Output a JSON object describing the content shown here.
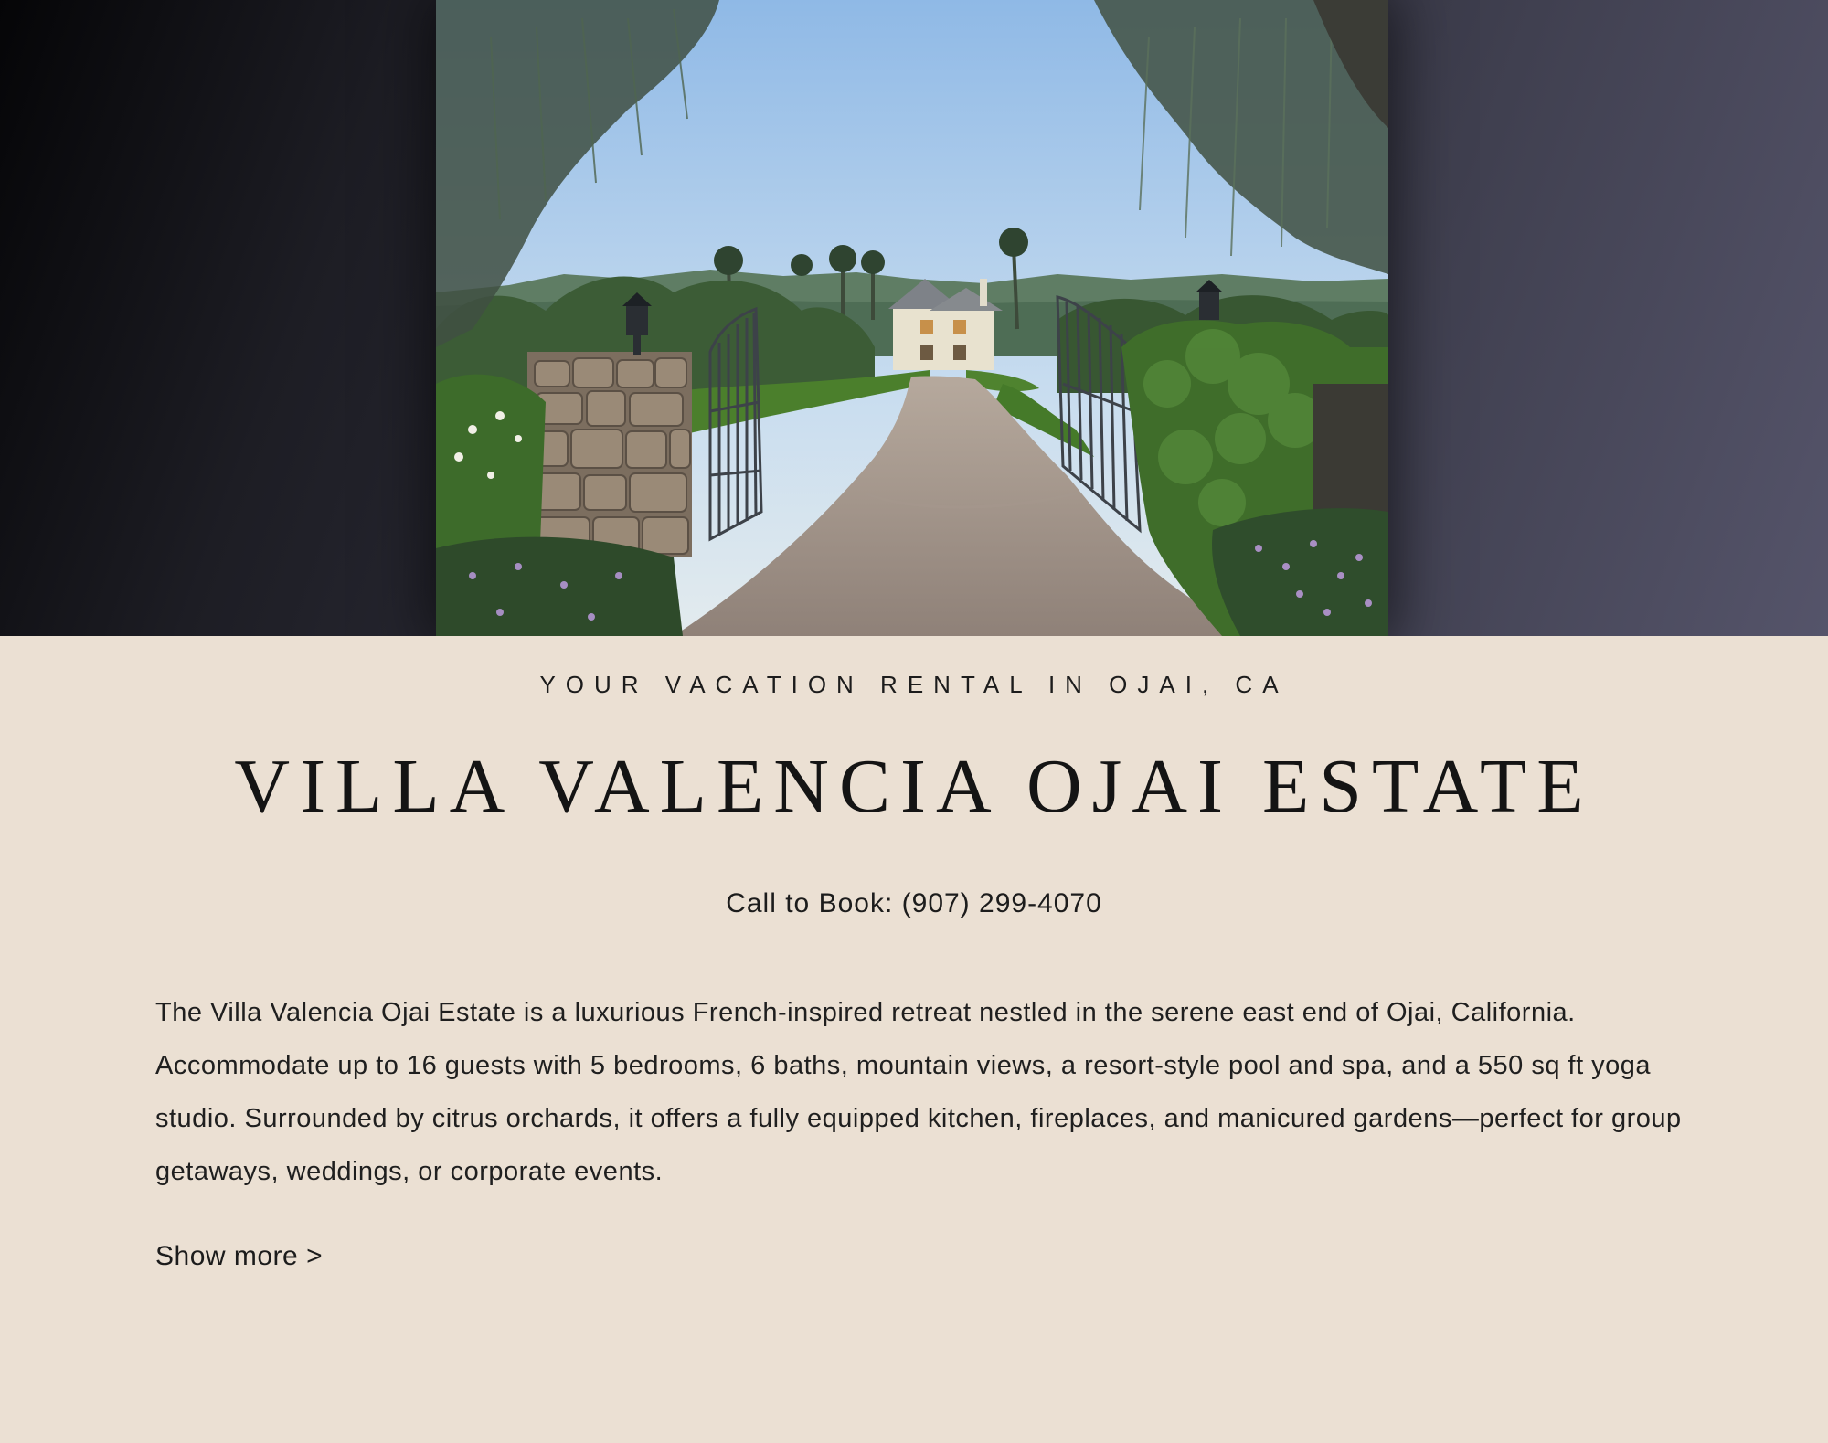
{
  "hero": {
    "image_alt": "Driveway through open iron gates leading to the estate"
  },
  "listing": {
    "eyebrow": "YOUR VACATION RENTAL IN OJAI, CA",
    "title": "VILLA VALENCIA OJAI ESTATE",
    "phone_label": "Call to Book:",
    "phone_number": "(907) 299-4070",
    "description": "The Villa Valencia Ojai Estate is a luxurious French-inspired retreat nestled in the serene east end of Ojai, California. Accommodate up to 16 guests with 5 bedrooms, 6 baths, mountain views, a resort-style pool and spa, and a 550 sq ft yoga studio. Surrounded by citrus orchards, it offers a fully equipped kitchen, fireplaces, and manicured gardens—perfect for group getaways, weddings, or corporate events.",
    "show_more": "Show more >"
  }
}
